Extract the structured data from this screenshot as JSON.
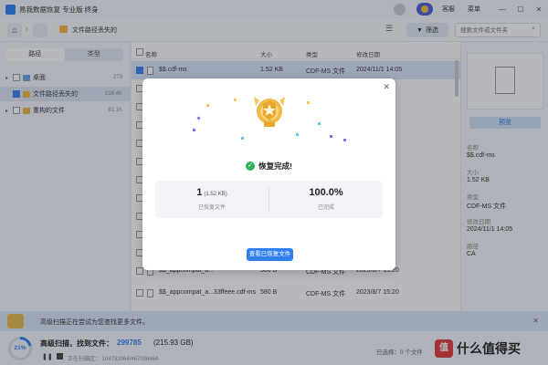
{
  "window": {
    "title": "易我数据恢复 专业版 终身",
    "support_label": "客服",
    "menu_label": "菜单",
    "minimize": "—",
    "maximize": "☐",
    "close": "✕"
  },
  "toolbar": {
    "breadcrumb": "文件路径丢失的",
    "filter_label": "筛选",
    "search_placeholder": "搜索文件或文件夹"
  },
  "sidebar": {
    "tabs": [
      "路径",
      "类型"
    ],
    "items": [
      {
        "label": "桌面",
        "count": "273"
      },
      {
        "label": "文件路径丢失的",
        "count": "218.4K"
      },
      {
        "label": "重构的文件",
        "count": "81.1K"
      }
    ]
  },
  "table": {
    "headers": [
      "名称",
      "大小",
      "类型",
      "修改日期"
    ],
    "rows": [
      {
        "name": "$$.cdf-ms",
        "size": "1.52 KB",
        "type": "CDF-MS 文件",
        "date": "2024/11/1 14:05"
      },
      {
        "name": "",
        "size": "",
        "type": "",
        "date": "14:05"
      },
      {
        "name": "",
        "size": "",
        "type": "",
        "date": "14:05"
      },
      {
        "name": "",
        "size": "",
        "type": "",
        "date": "9:32"
      },
      {
        "name": "",
        "size": "",
        "type": "",
        "date": ":32"
      },
      {
        "name": "",
        "size": "",
        "type": "",
        "date": "9:32"
      },
      {
        "name": "",
        "size": "",
        "type": "",
        "date": "9:32"
      },
      {
        "name": "",
        "size": "",
        "type": "",
        "date": "9:32"
      },
      {
        "name": "",
        "size": "",
        "type": "",
        "date": "9:32"
      },
      {
        "name": "",
        "size": "",
        "type": "",
        "date": "9:32"
      },
      {
        "name": "",
        "size": "",
        "type": "",
        "date": "9:32"
      },
      {
        "name": "$$_appcompat_a...",
        "size": "580 B",
        "type": "CDF-MS 文件",
        "date": "2023/8/7 15:20"
      },
      {
        "name": "$$_appcompat_a...33ffeee.cdf-ms",
        "size": "580 B",
        "type": "CDF-MS 文件",
        "date": "2023/8/7 15:20"
      }
    ]
  },
  "preview": {
    "button": "预览",
    "name_key": "名称",
    "name_val": "$$.cdf-ms",
    "size_key": "大小",
    "size_val": "1.52 KB",
    "type_key": "类型",
    "type_val": "CDF-MS 文件",
    "date_key": "修改日期",
    "date_val": "2024/11/1 14:05",
    "path_key": "路径",
    "path_val": "CA"
  },
  "notice": {
    "text": "高级扫描正在尝试为您查找更多文件。",
    "close": "✕"
  },
  "status": {
    "percent": "21%",
    "progress": 0.21,
    "scan_title": "高级扫描，找到文件：",
    "found_count": "299785",
    "found_size": "(215.93 GB)",
    "scan_progress": "正在扫描区： 104792064/467006464",
    "selected": "已选择：0 个文件"
  },
  "brand": {
    "badge": "值",
    "text": "什么值得买"
  },
  "dialog": {
    "close": "✕",
    "status": "恢复完成!",
    "recovered_count": "1",
    "recovered_size": "(1.52 KB)",
    "recovered_label": "已恢复文件",
    "percent": "100.0%",
    "percent_label": "已完成",
    "view_button": "查看已恢复文件"
  }
}
